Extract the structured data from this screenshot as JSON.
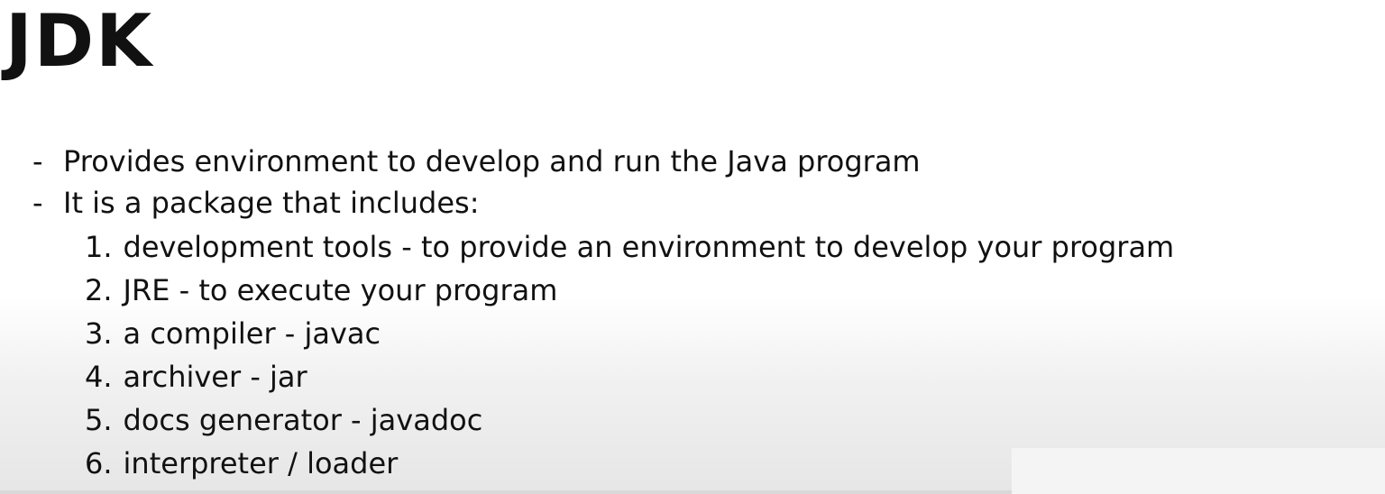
{
  "slide": {
    "title": "JDK",
    "bullets": [
      {
        "marker": "-",
        "text": "Provides environment to develop and run the Java program"
      },
      {
        "marker": "-",
        "text": "It is a package that includes:"
      }
    ],
    "items": [
      {
        "number": "1.",
        "text": "development tools - to provide an environment to develop your program"
      },
      {
        "number": "2.",
        "text": "JRE - to execute your program"
      },
      {
        "number": "3.",
        "text": "a compiler - javac"
      },
      {
        "number": "4.",
        "text": "archiver - jar"
      },
      {
        "number": "5.",
        "text": "docs generator - javadoc"
      },
      {
        "number": "6.",
        "text": "interpreter / loader"
      }
    ]
  }
}
